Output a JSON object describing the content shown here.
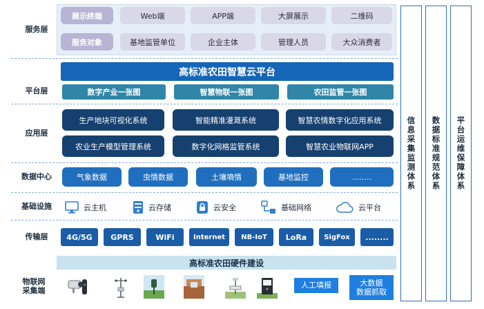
{
  "service": {
    "label": "服务层",
    "row1": {
      "tag": "展示终端",
      "items": [
        "Web端",
        "APP端",
        "大屏展示",
        "二维码"
      ]
    },
    "row2": {
      "tag": "服务对象",
      "items": [
        "基地监管单位",
        "企业主体",
        "管理人员",
        "大众消费者"
      ]
    }
  },
  "platform": {
    "label": "平台层",
    "title": "高标准农田智慧云平台",
    "maps": [
      "数字产业一张图",
      "智慧物联一张图",
      "农田监管一张图"
    ]
  },
  "application": {
    "label": "应用层",
    "systems": [
      "生产地块可视化系统",
      "智能精准灌溉系统",
      "智慧农情数字化应用系统",
      "农业生产模型管理系统",
      "数字化网格监管系统",
      "智慧农业物联网APP"
    ]
  },
  "data_center": {
    "label": "数据中心",
    "items": [
      "气象数据",
      "虫情数据",
      "土壤墒情",
      "基地监控",
      "........"
    ]
  },
  "infrastructure": {
    "label": "基础设施",
    "items": [
      {
        "icon": "monitor-icon",
        "label": "云主机"
      },
      {
        "icon": "server-icon",
        "label": "云存储"
      },
      {
        "icon": "shield-icon",
        "label": "云安全"
      },
      {
        "icon": "network-icon",
        "label": "基础网络"
      },
      {
        "icon": "cloud-icon",
        "label": "云平台"
      }
    ]
  },
  "transport": {
    "label": "传输层",
    "items": [
      "4G/5G",
      "GPRS",
      "WiFi",
      "Internet",
      "NB-IoT",
      "LoRa",
      "SigFox",
      "........"
    ]
  },
  "hardware": {
    "bar_title": "高标准农田硬件建设",
    "label_line1": "物联网",
    "label_line2": "采集端",
    "devices": [
      "camera-icon",
      "weather-station-icon",
      "insect-lamp-icon",
      "soil-sensor-icon",
      "pole-sensor-icon",
      "control-cabinet-icon"
    ],
    "manual": "人工填报",
    "bigdata_line1": "大数据",
    "bigdata_line2": "数据抓取"
  },
  "systems": [
    "信息采集监测体系",
    "数据标准规范体系",
    "平台运维保障体系"
  ]
}
